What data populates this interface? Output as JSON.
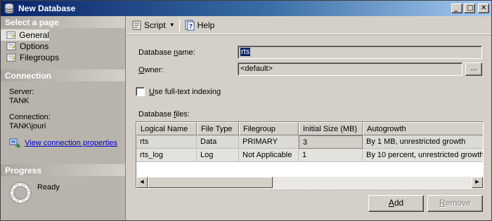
{
  "window": {
    "title": "New Database"
  },
  "sidebar": {
    "select_page_header": "Select a page",
    "pages": [
      {
        "label": "General",
        "icon": "page-icon"
      },
      {
        "label": "Options",
        "icon": "page-icon"
      },
      {
        "label": "Filegroups",
        "icon": "page-icon"
      }
    ],
    "connection_header": "Connection",
    "server_label": "Server:",
    "server_value": "TANK",
    "connection_label": "Connection:",
    "connection_value": "TANK\\jouri",
    "view_connection_link": "View connection properties",
    "progress_header": "Progress",
    "progress_status": "Ready"
  },
  "toolbar": {
    "script_label": "Script",
    "help_label": "Help"
  },
  "form": {
    "database_name_label_pre": "Database ",
    "database_name_label_u": "n",
    "database_name_label_post": "ame:",
    "database_name_value": "rts",
    "owner_label_u": "O",
    "owner_label_post": "wner:",
    "owner_value": "<default>",
    "owner_browse_label": "...",
    "fulltext_label_u": "U",
    "fulltext_label_post": "se full-text indexing",
    "fulltext_checked": false,
    "database_files_label_pre": "Database ",
    "database_files_label_u": "f",
    "database_files_label_post": "iles:"
  },
  "files_table": {
    "columns": [
      "Logical Name",
      "File Type",
      "Filegroup",
      "Initial Size (MB)",
      "Autogrowth"
    ],
    "rows": [
      [
        "rts",
        "Data",
        "PRIMARY",
        "3",
        "By 1 MB, unrestricted growth"
      ],
      [
        "rts_log",
        "Log",
        "Not Applicable",
        "1",
        "By 10 percent, unrestricted growth"
      ]
    ]
  },
  "buttons": {
    "add_u": "A",
    "add_post": "dd",
    "remove_u": "R",
    "remove_post": "emove",
    "remove_enabled": false
  }
}
